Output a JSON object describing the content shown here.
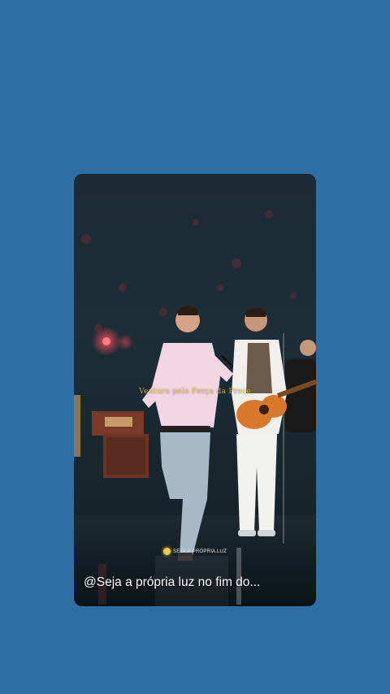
{
  "story": {
    "overlay_text": "Ventura pela Força da Prece",
    "account_label": "SEJA.A.PRÓPRIA.LUZ",
    "account_icon": "lightbulb-icon",
    "caption": "@Seja a própria luz no fim do..."
  },
  "colors": {
    "background": "#2e70a5",
    "overlay_text": "#e8c548"
  }
}
